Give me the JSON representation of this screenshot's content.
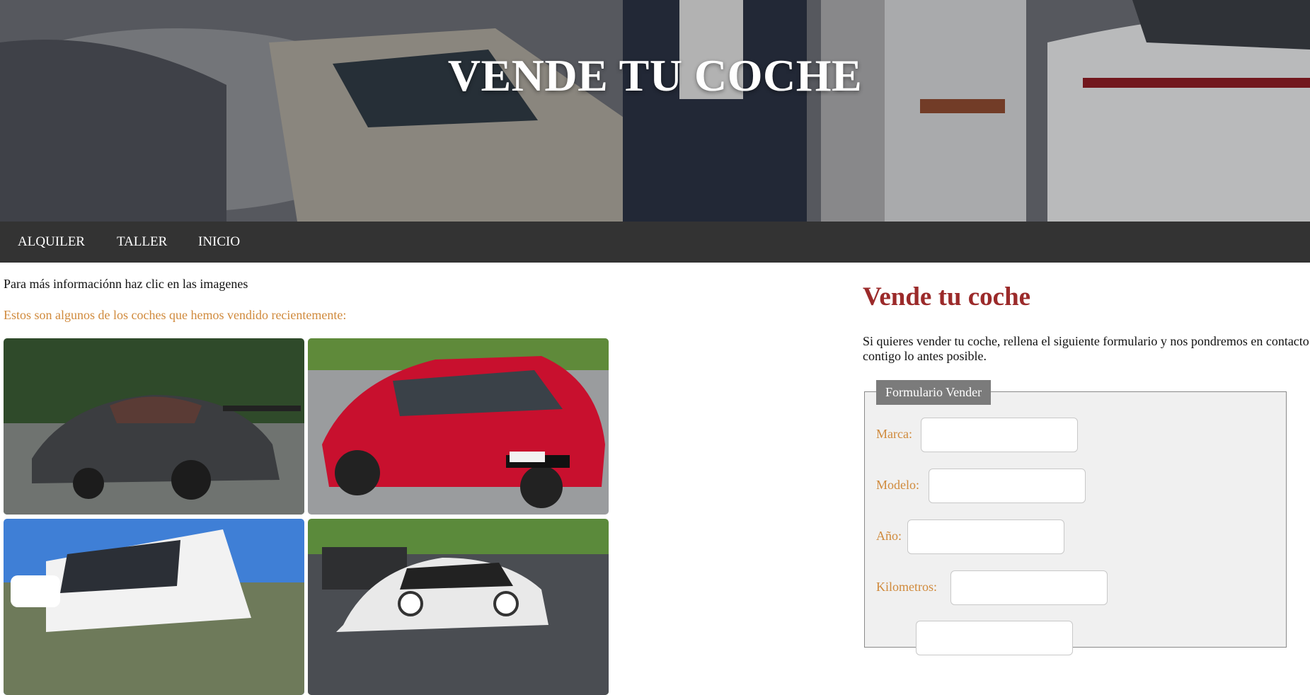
{
  "hero": {
    "title": "VENDE TU COCHE"
  },
  "nav": {
    "items": [
      "ALQUILER",
      "TALLER",
      "INICIO"
    ]
  },
  "main": {
    "info_text": "Para más informaciónn haz clic en las imagenes",
    "sold_text": "Estos son algunos de los coches que hemos vendido recientemente:",
    "cars": [
      {
        "icon": "grey-sports-car-photo",
        "color": "#3b3d40"
      },
      {
        "icon": "red-sedan-photo",
        "color": "#c8102e"
      },
      {
        "icon": "white-van-photo",
        "color": "#f2f2f2"
      },
      {
        "icon": "white-mini-photo",
        "color": "#e9e9e9"
      }
    ]
  },
  "form": {
    "title": "Vende tu coche",
    "description": "Si quieres vender tu coche, rellena el siguiente formulario y nos pondremos en contacto contigo lo antes posible.",
    "legend": "Formulario Vender",
    "fields": [
      {
        "label": "Marca:",
        "value": ""
      },
      {
        "label": "Modelo:",
        "value": ""
      },
      {
        "label": "Año:",
        "value": ""
      },
      {
        "label": "Kilometros:",
        "value": ""
      },
      {
        "label": "",
        "value": ""
      }
    ]
  },
  "colors": {
    "nav_bg": "#333333",
    "accent_orange": "#d08a3c",
    "title_red": "#9b2a2a",
    "legend_bg": "#7b7b7b",
    "fieldset_bg": "#f0f0f0"
  }
}
